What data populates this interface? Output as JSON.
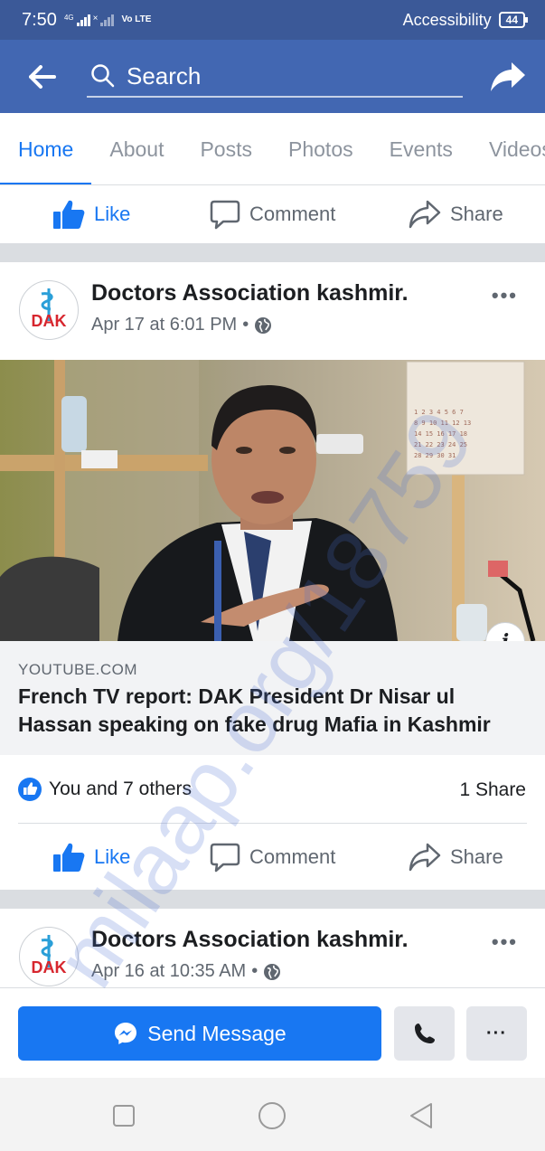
{
  "status_bar": {
    "time": "7:50",
    "network": "4G",
    "volte": "Vo LTE",
    "accessibility": "Accessibility",
    "battery": "44"
  },
  "app_bar": {
    "search_placeholder": "Search",
    "background": "#4267b2"
  },
  "tabs": [
    {
      "label": "Home",
      "active": true
    },
    {
      "label": "About",
      "active": false
    },
    {
      "label": "Posts",
      "active": false
    },
    {
      "label": "Photos",
      "active": false
    },
    {
      "label": "Events",
      "active": false
    },
    {
      "label": "Videos",
      "active": false
    }
  ],
  "actions": {
    "like": "Like",
    "comment": "Comment",
    "share": "Share"
  },
  "posts": [
    {
      "author": "Doctors Association kashmir.",
      "avatar_text": "DAK",
      "time": "Apr 17 at 6:01 PM",
      "link_source": "YOUTUBE.COM",
      "link_title_line1": "French TV report: DAK President Dr Nisar ul",
      "link_title_line2": "Hassan speaking on fake drug Mafia in Kashmir",
      "reactions": "You and 7 others",
      "shares": "1 Share"
    },
    {
      "author": "Doctors Association kashmir.",
      "avatar_text": "DAK",
      "time": "Apr 16 at 10:35 AM"
    }
  ],
  "message_bar": {
    "send_label": "Send Message",
    "menu_label": "···"
  },
  "watermark": "milaap.org/18759",
  "colors": {
    "accent": "#1877f2",
    "brand": "#3b5998"
  }
}
